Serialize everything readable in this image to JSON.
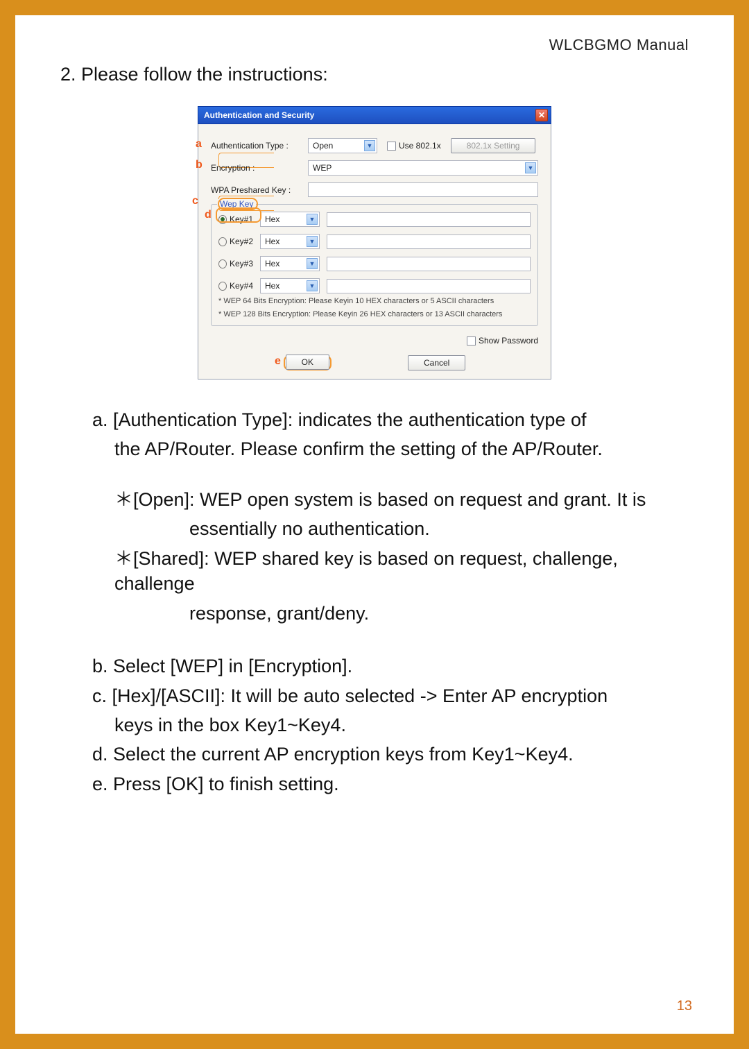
{
  "header": {
    "manual": "WLCBGMO  Manual"
  },
  "title": "2. Please follow the instructions:",
  "dialog": {
    "title": "Authentication and Security",
    "labels": {
      "auth_type": "Authentication Type :",
      "encryption": "Encryption :",
      "wpa_psk": "WPA Preshared Key :",
      "wep_key_legend": "Wep Key"
    },
    "auth_type_value": "Open",
    "use_8021x": "Use 802.1x",
    "btn_8021x": "802.1x Setting",
    "encryption_value": "WEP",
    "keys": [
      {
        "name": "Key#1",
        "format": "Hex",
        "selected": true
      },
      {
        "name": "Key#2",
        "format": "Hex",
        "selected": false
      },
      {
        "name": "Key#3",
        "format": "Hex",
        "selected": false
      },
      {
        "name": "Key#4",
        "format": "Hex",
        "selected": false
      }
    ],
    "hint1": "* WEP 64 Bits Encryption:  Please Keyin 10 HEX characters or 5 ASCII characters",
    "hint2": "* WEP 128 Bits Encryption:  Please Keyin 26 HEX characters or 13 ASCII characters",
    "show_password": "Show Password",
    "ok": "OK",
    "cancel": "Cancel"
  },
  "letters": {
    "a": "a",
    "b": "b",
    "c": "c",
    "d": "d",
    "e": "e"
  },
  "body": {
    "a1": "a. [Authentication Type]: indicates the authentication type of",
    "a2": "the AP/Router. Please confirm the setting of the AP/Router.",
    "open1": "＊[Open]: WEP open system is based on request and grant. It is",
    "open2": "essentially no authentication.",
    "shared1": "＊[Shared]: WEP shared key is based on request, challenge, challenge",
    "shared2": "response, grant/deny.",
    "b": "b. Select  [WEP] in [Encryption].",
    "c1": "c. [Hex]/[ASCII]: It will be auto selected -> Enter AP encryption",
    "c2": "keys in the box Key1~Key4.",
    "d": "d. Select the current AP encryption keys from Key1~Key4.",
    "e": "e. Press [OK] to finish setting."
  },
  "page_number": "13"
}
